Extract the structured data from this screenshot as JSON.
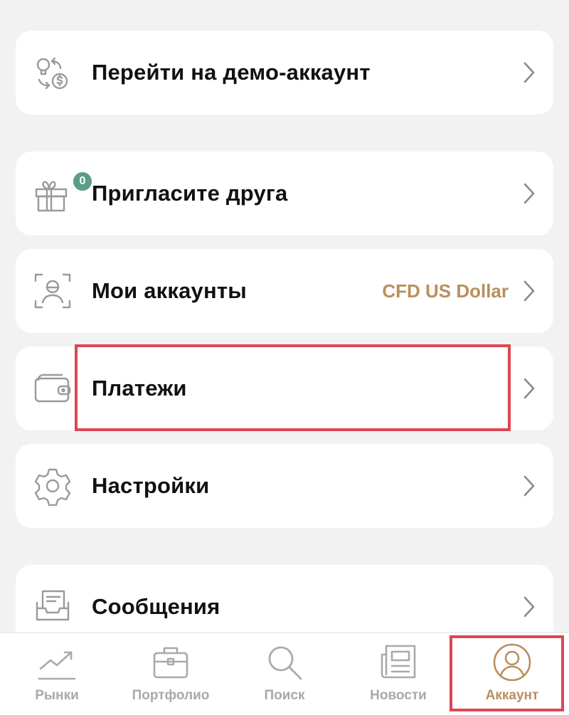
{
  "colors": {
    "background": "#f2f2f2",
    "card": "#ffffff",
    "text": "#111111",
    "icon_gray": "#9a9a9a",
    "accent_gold": "#b98f5e",
    "badge_green": "#5a9e87",
    "highlight_red": "#dd4654"
  },
  "menu": {
    "demo": {
      "label": "Перейти на демо-аккаунт",
      "icon": "light-bulb-dollar-icon"
    },
    "invite": {
      "label": "Пригласите друга",
      "icon": "gift-icon",
      "badge": "0"
    },
    "accounts": {
      "label": "Мои аккаунты",
      "value": "CFD US Dollar",
      "icon": "user-scan-icon"
    },
    "payments": {
      "label": "Платежи",
      "icon": "wallet-icon"
    },
    "settings": {
      "label": "Настройки",
      "icon": "gear-icon"
    },
    "messages": {
      "label": "Сообщения",
      "icon": "inbox-tray-icon"
    }
  },
  "tabs": [
    {
      "label": "Рынки",
      "icon": "trend-chart-icon"
    },
    {
      "label": "Портфолио",
      "icon": "briefcase-icon"
    },
    {
      "label": "Поиск",
      "icon": "search-icon"
    },
    {
      "label": "Новости",
      "icon": "newspaper-icon"
    },
    {
      "label": "Аккаунт",
      "icon": "user-circle-icon",
      "active": true
    }
  ]
}
